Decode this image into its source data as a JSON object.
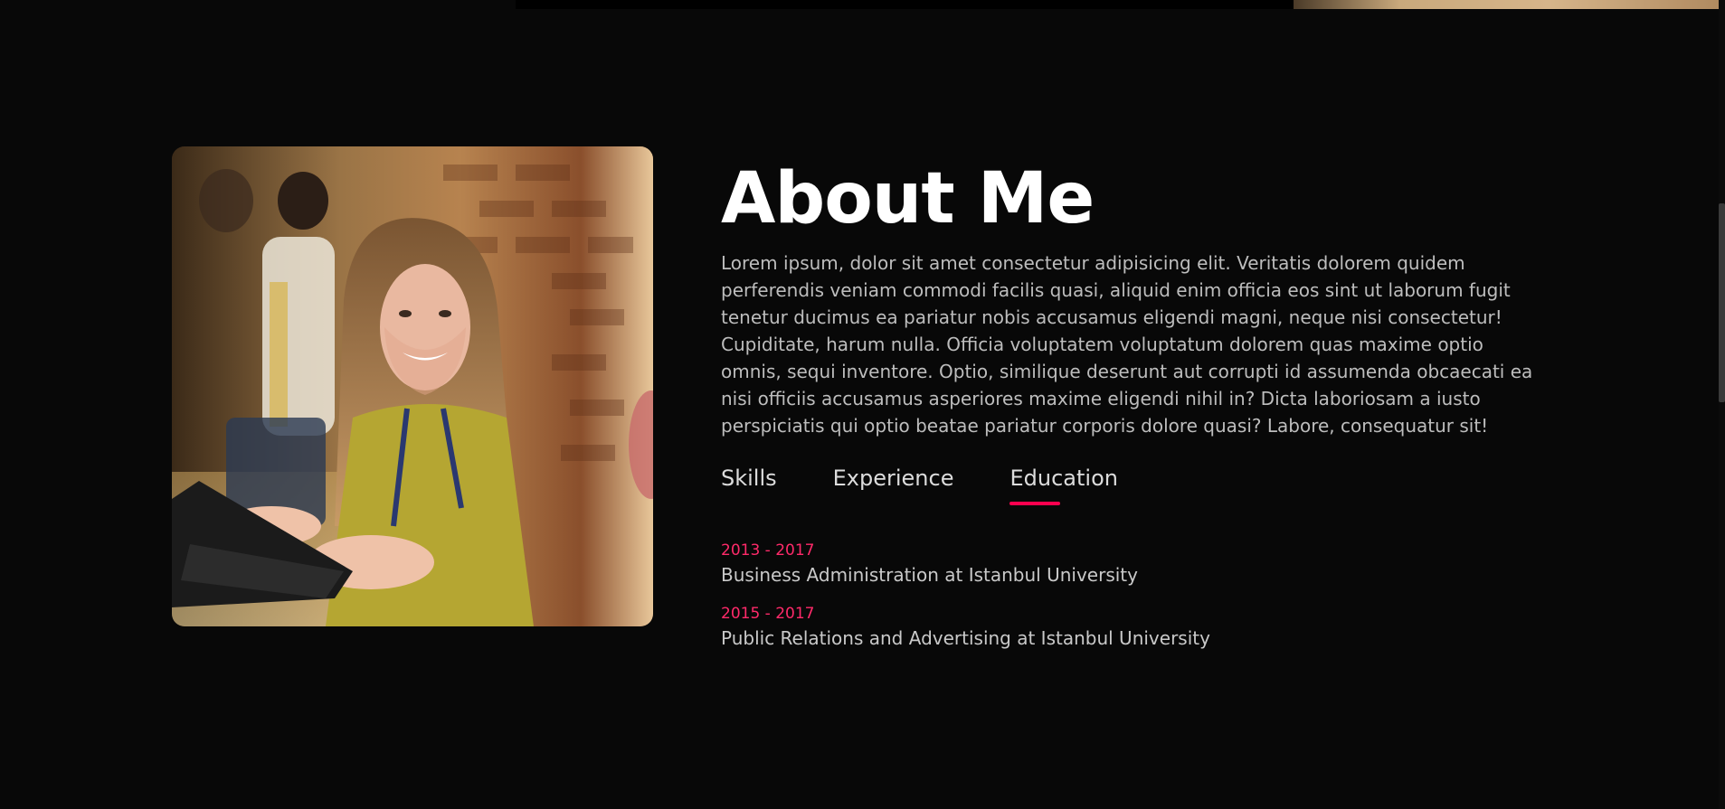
{
  "about": {
    "title": "About Me",
    "paragraph": "Lorem ipsum, dolor sit amet consectetur adipisicing elit. Veritatis dolorem quidem perferendis veniam commodi facilis quasi, aliquid enim officia eos sint ut laborum fugit tenetur ducimus ea pariatur nobis accusamus eligendi magni, neque nisi consectetur! Cupiditate, harum nulla. Officia voluptatem voluptatum dolorem quas maxime optio omnis, sequi inventore. Optio, similique deserunt aut corrupti id assumenda obcaecati ea nisi officiis accusamus asperiores maxime eligendi nihil in? Dicta laboriosam a iusto perspiciatis qui optio beatae pariatur corporis dolore quasi? Labore, consequatur sit!"
  },
  "tabs": {
    "items": [
      {
        "label": "Skills"
      },
      {
        "label": "Experience"
      },
      {
        "label": "Education"
      }
    ],
    "active": "Education"
  },
  "education": [
    {
      "years": "2013 - 2017",
      "description": "Business Administration at Istanbul University"
    },
    {
      "years": "2015 - 2017",
      "description": "Public Relations and Advertising at Istanbul University"
    }
  ],
  "colors": {
    "background": "#080808",
    "accent": "#ff004f",
    "text": "#bdbdbd",
    "heading": "#ffffff"
  }
}
